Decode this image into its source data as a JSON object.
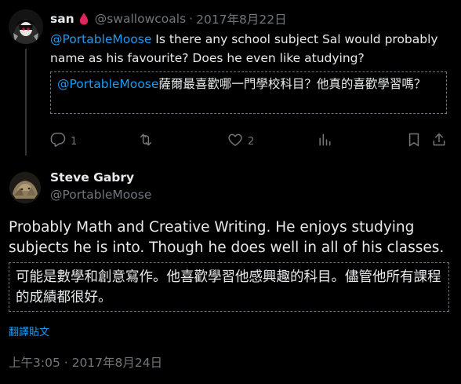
{
  "reply": {
    "author_name": "san",
    "author_handle": "@swallowcoals",
    "separator": "·",
    "date": "2017年8月22日",
    "body_mention": "@PortableMoose",
    "body_text": " Is there any school subject Sal would probably name as his favourite? Does he even like atudying?",
    "translation_mention": "@PortableMoose",
    "translation_text": "薩爾最喜歡哪一門學校科目？他真的喜歡學習嗎？",
    "actions": {
      "reply_count": "1",
      "retweet_count": "",
      "like_count": "2"
    }
  },
  "main": {
    "author_name": "Steve Gabry",
    "author_handle": "@PortableMoose",
    "body_text": "Probably Math and Creative Writing. He enjoys studying subjects he is into. Though he does well in all of his classes.",
    "translation_text": "可能是數學和創意寫作。他喜歡學習他感興趣的科目。儘管他所有課程的成績都很好。",
    "translate_link": "翻譯貼文",
    "timestamp": "上午3:05 · 2017年8月24日"
  },
  "colors": {
    "background": "#000000",
    "text": "#e7e9ea",
    "secondary": "#71767b",
    "accent": "#1d9bf0",
    "drop_icon": "#e0245e"
  },
  "icons": {
    "reply": "reply-icon",
    "retweet": "retweet-icon",
    "like": "heart-icon",
    "views": "views-icon",
    "bookmark": "bookmark-icon",
    "share": "share-icon",
    "badge": "blood-drop-icon"
  }
}
